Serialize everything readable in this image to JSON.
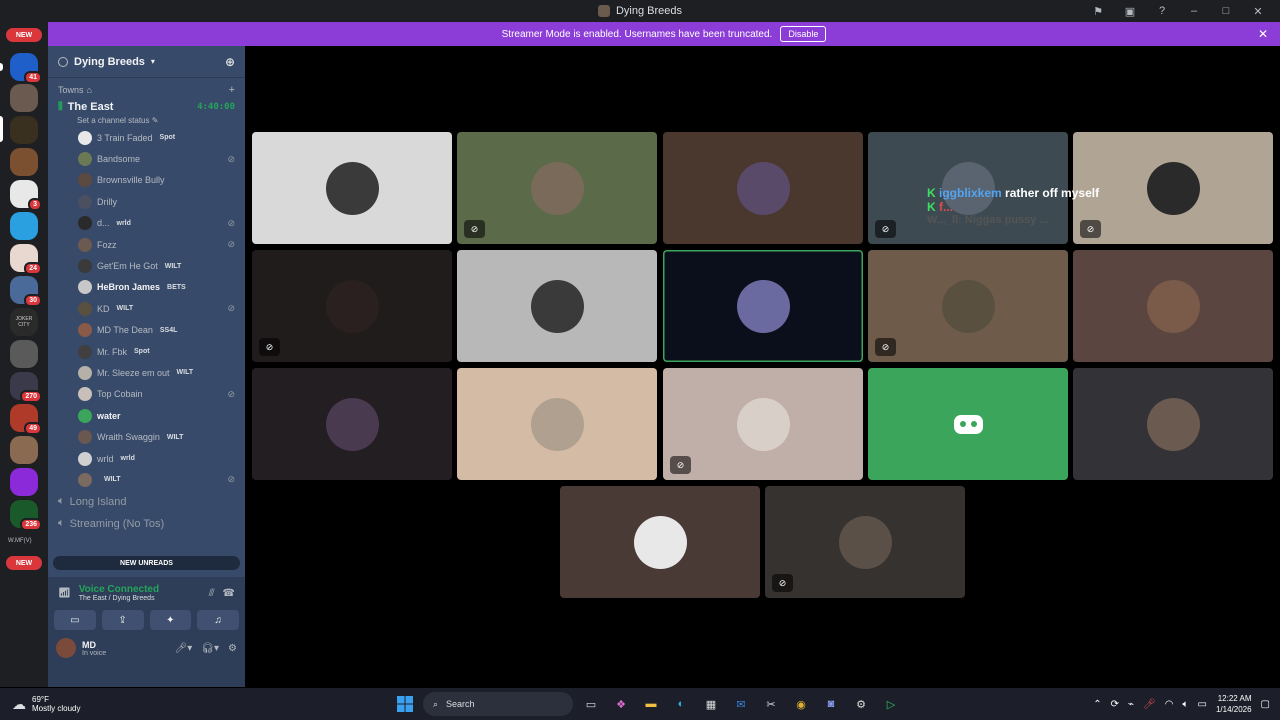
{
  "window": {
    "title": "Dying Breeds"
  },
  "banner": {
    "text": "Streamer Mode is enabled. Usernames have been truncated.",
    "disable_label": "Disable"
  },
  "rail": {
    "new_top": "NEW",
    "new_bottom": "NEW",
    "badges": [
      "41",
      "3",
      "24",
      "30",
      "270",
      "49",
      "236"
    ],
    "labels": {
      "joker": "JOKER CITY",
      "wmfv": "W.MF(V)"
    }
  },
  "guild": {
    "name": "Dying Breeds"
  },
  "category": {
    "name": "Towns"
  },
  "voice_channel": {
    "name": "The East",
    "timer": "4:40:00",
    "status_prompt": "Set a channel status"
  },
  "members": [
    {
      "name": "3 Train Faded",
      "tag": "Spot",
      "color": "#e8e8e8",
      "muted": false,
      "bold": false
    },
    {
      "name": "Bandsome",
      "tag": "",
      "color": "#6b7a55",
      "muted": true,
      "bold": false
    },
    {
      "name": "Brownsville Bully",
      "tag": "",
      "color": "#5a4a40",
      "muted": false,
      "bold": false
    },
    {
      "name": "Drilly",
      "tag": "",
      "color": "#4a5060",
      "muted": false,
      "bold": false
    },
    {
      "name": "d...",
      "tag": "wrld",
      "color": "#2a2a2a",
      "muted": true,
      "bold": false
    },
    {
      "name": "Fozz",
      "tag": "",
      "color": "#6a5a50",
      "muted": true,
      "bold": false
    },
    {
      "name": "Get'Em He Got",
      "tag": "WILT",
      "color": "#3a3a3a",
      "muted": false,
      "bold": false
    },
    {
      "name": "HeBron James",
      "tag": "BETS",
      "color": "#c8c8c8",
      "muted": false,
      "bold": true
    },
    {
      "name": "KD",
      "tag": "WILT",
      "color": "#5a5040",
      "muted": true,
      "bold": false
    },
    {
      "name": "MD The Dean",
      "tag": "SS4L",
      "color": "#8a5a48",
      "muted": false,
      "bold": false
    },
    {
      "name": "Mr. Fbk",
      "tag": "Spot",
      "color": "#404040",
      "muted": false,
      "bold": false
    },
    {
      "name": "Mr. Sleeze em out",
      "tag": "WILT",
      "color": "#b5b0a8",
      "muted": false,
      "bold": false
    },
    {
      "name": "Top Cobain",
      "tag": "",
      "color": "#c8c0b8",
      "muted": true,
      "bold": false
    },
    {
      "name": "water",
      "tag": "",
      "color": "#3ba55c",
      "muted": false,
      "bold": true
    },
    {
      "name": "Wraith Swaggin",
      "tag": "WILT",
      "color": "#6a5850",
      "muted": false,
      "bold": false
    },
    {
      "name": "wrld",
      "tag": "wrld",
      "color": "#d0d0d0",
      "muted": false,
      "bold": false
    },
    {
      "name": "",
      "tag": "WILT",
      "color": "#7a6a60",
      "muted": true,
      "bold": false
    }
  ],
  "other_channels": [
    "Long Island",
    "Streaming (No Tos)"
  ],
  "new_unreads": "NEW UNREADS",
  "voice_panel": {
    "status": "Voice Connected",
    "location": "The East / Dying Breeds"
  },
  "user": {
    "name": "MD",
    "status": "In voice"
  },
  "tiles": [
    {
      "bg": "#d9d9d9",
      "av": "#3a3a3a",
      "muted": false,
      "speaking": false
    },
    {
      "bg": "#5b6b4a",
      "av": "#7a6a5a",
      "muted": true,
      "speaking": false
    },
    {
      "bg": "#4a372e",
      "av": "#5a4a6a",
      "muted": false,
      "speaking": false
    },
    {
      "bg": "#3d4a52",
      "av": "#5a6470",
      "muted": true,
      "speaking": false
    },
    {
      "bg": "#b0a595",
      "av": "#2a2a2a",
      "muted": true,
      "speaking": false
    },
    {
      "bg": "#201c1c",
      "av": "#2a2020",
      "muted": true,
      "speaking": false
    },
    {
      "bg": "#b8b8b8",
      "av": "#3a3a3a",
      "muted": false,
      "speaking": false
    },
    {
      "bg": "#0b0f1c",
      "av": "#6a6aa0",
      "muted": false,
      "speaking": true
    },
    {
      "bg": "#6e5b4a",
      "av": "#5a5040",
      "muted": true,
      "speaking": false
    },
    {
      "bg": "#5a4540",
      "av": "#7a5a48",
      "muted": false,
      "speaking": false
    },
    {
      "bg": "#221e22",
      "av": "#4a3a50",
      "muted": false,
      "speaking": false
    },
    {
      "bg": "#d4bba6",
      "av": "#b0a090",
      "muted": false,
      "speaking": false
    },
    {
      "bg": "#c0aea8",
      "av": "#d8d0c8",
      "muted": true,
      "speaking": false
    },
    {
      "bg": "#3ba55c",
      "av": "#3ba55c",
      "muted": false,
      "speaking": false
    },
    {
      "bg": "#333236",
      "av": "#6a5a50",
      "muted": false,
      "speaking": false
    },
    {
      "bg": "#4a3a36",
      "av": "#e8e8e8",
      "muted": false,
      "speaking": false
    },
    {
      "bg": "#363230",
      "av": "#5a5048",
      "muted": true,
      "speaking": false
    }
  ],
  "chat_overlay": {
    "line1_name": "iggblixkem",
    "line1_text": "rather off myself",
    "line2_name": "f...",
    "line3_text": "W..._ll: Niggas pussy ..."
  },
  "taskbar": {
    "temp": "69°F",
    "weather": "Mostly cloudy",
    "search": "Search",
    "time": "12:22 AM",
    "date": "1/14/2026"
  }
}
